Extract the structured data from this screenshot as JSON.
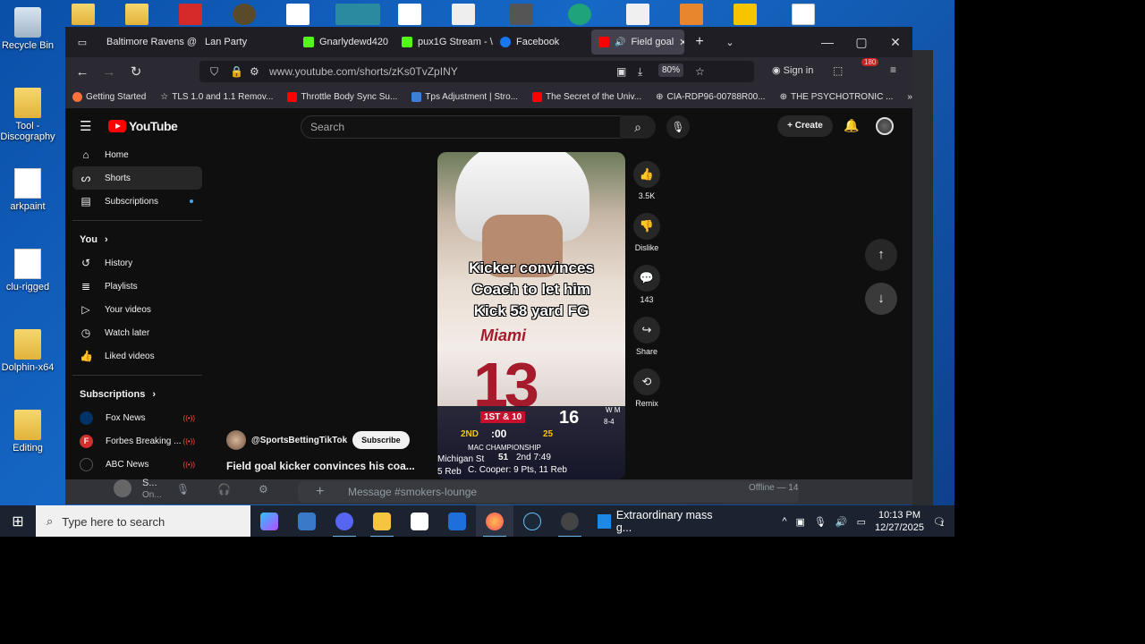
{
  "desktop": {
    "icons": [
      {
        "label": "Recycle Bin"
      },
      {
        "label": "Tool - Discography"
      },
      {
        "label": "arkpaint"
      },
      {
        "label": "clu-rigged"
      },
      {
        "label": "Dolphin-x64"
      },
      {
        "label": "Editing"
      }
    ]
  },
  "browser": {
    "tabs": [
      {
        "label": "Baltimore Ravens @"
      },
      {
        "label": "Lan Party"
      },
      {
        "label": "Gnarlydewd420"
      },
      {
        "label": "pux1G Stream - \\"
      },
      {
        "label": "Facebook"
      },
      {
        "label": "Field goal"
      }
    ],
    "new_tab": "+",
    "tab_list": "⌄",
    "url": "www.youtube.com/shorts/zKs0TvZpINY",
    "zoom": "80%",
    "sign_in": "Sign in",
    "badge": "180",
    "bookmarks": [
      {
        "label": "Getting Started"
      },
      {
        "label": "TLS 1.0 and 1.1 Remov..."
      },
      {
        "label": "Throttle Body Sync Su..."
      },
      {
        "label": "Tps Adjustment | Stro..."
      },
      {
        "label": "The Secret of the Univ..."
      },
      {
        "label": "CIA-RDP96-00788R00..."
      },
      {
        "label": "THE PSYCHOTRONIC ..."
      }
    ]
  },
  "youtube": {
    "logo": "YouTube",
    "search_placeholder": "Search",
    "create": "Create",
    "sidebar": {
      "main": [
        {
          "label": "Home",
          "icon": "home-icon"
        },
        {
          "label": "Shorts",
          "icon": "shorts-icon"
        },
        {
          "label": "Subscriptions",
          "icon": "subscriptions-icon"
        }
      ],
      "you_heading": "You",
      "you": [
        {
          "label": "History"
        },
        {
          "label": "Playlists"
        },
        {
          "label": "Your videos"
        },
        {
          "label": "Watch later"
        },
        {
          "label": "Liked videos"
        }
      ],
      "subs_heading": "Subscriptions",
      "subs": [
        {
          "label": "Fox News",
          "color": "#003366"
        },
        {
          "label": "Forbes Breaking ...",
          "color": "#d32f2f"
        },
        {
          "label": "ABC News",
          "color": "#111111"
        }
      ]
    },
    "short": {
      "caption_lines": [
        "Kicker convinces",
        "Coach to let him",
        "Kick 58 yard FG"
      ],
      "jersey_text": "Miami",
      "jersey_number": "13",
      "score_down": "1ST & 10",
      "score_big": "16",
      "score_record": "8-4",
      "score_quarter": "2ND",
      "score_clock": ":00",
      "score_play": "25",
      "score_title": "MAC CHAMPIONSHIP",
      "score_team": "Michigan St",
      "score_team_pts": "51",
      "score_detail": "2nd 7:49",
      "score_player": "C. Cooper: 9 Pts, 11 Reb",
      "score_left": "5 Reb",
      "score_top_right": "W M",
      "channel": "@SportsBettingTikTok",
      "subscribe": "Subscribe",
      "title": "Field goal kicker convinces his coa..."
    },
    "actions": [
      {
        "label": "3.5K",
        "icon": "thumbs-up-icon"
      },
      {
        "label": "Dislike",
        "icon": "thumbs-down-icon"
      },
      {
        "label": "143",
        "icon": "comment-icon"
      },
      {
        "label": "Share",
        "icon": "share-icon"
      },
      {
        "label": "Remix",
        "icon": "remix-icon"
      }
    ]
  },
  "discord": {
    "user_short": "S...",
    "user_status": "On...",
    "message_placeholder": "Message #smokers-lounge",
    "offline": "Offline — 14"
  },
  "taskbar": {
    "search_placeholder": "Type here to search",
    "notification": "Extraordinary mass g...",
    "time": "10:13 PM",
    "date": "12/27/2025",
    "notif_count": "1"
  }
}
